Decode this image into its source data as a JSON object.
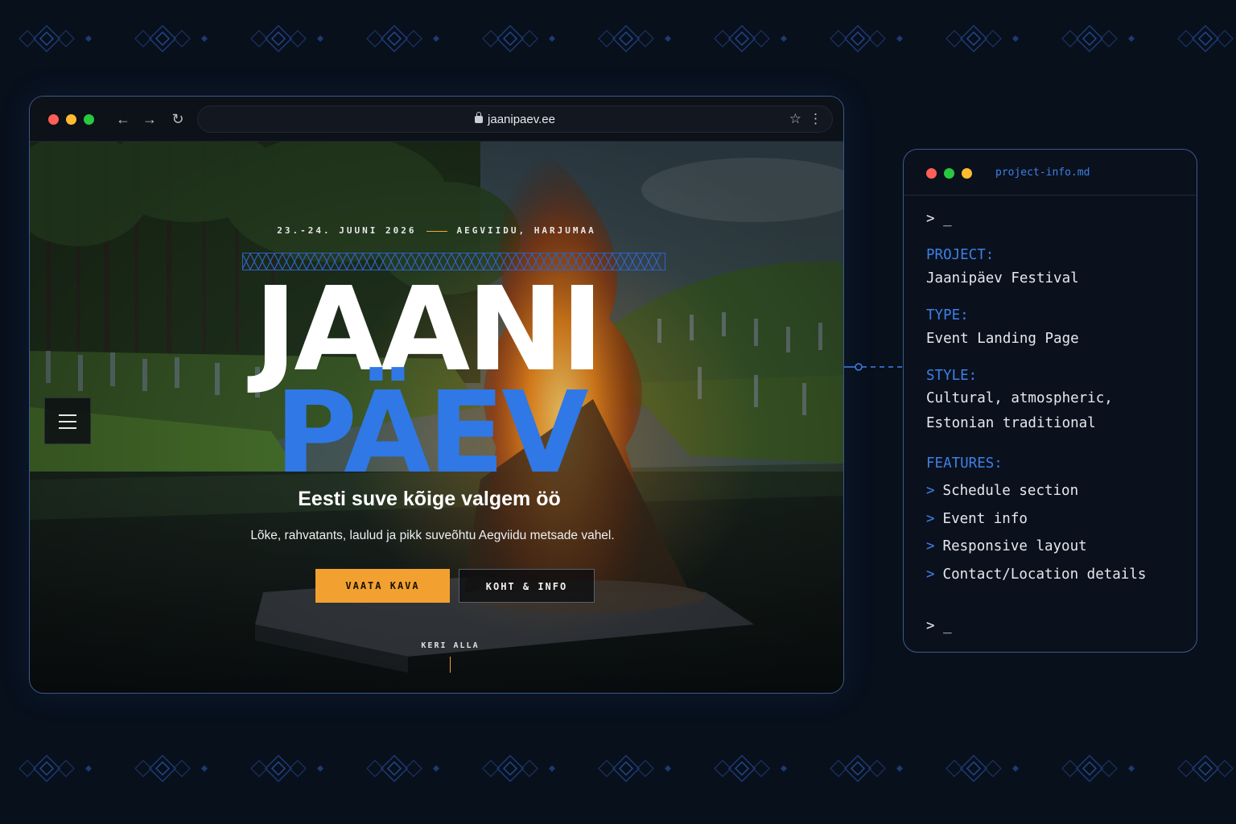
{
  "browser": {
    "url": "jaanipaev.ee",
    "traffic_colors": [
      "#ff5f57",
      "#febc2e",
      "#28c840"
    ]
  },
  "hero": {
    "date_text": "23.-24. JUUNI 2026",
    "location_text": "AEGVIIDU, HARJUMAA",
    "title_line1": "JAANI",
    "title_line2": "PÄEV",
    "tagline": "Eesti suve kõige valgem öö",
    "subline": "Lõke, rahvatants, laulud ja pikk suveõhtu Aegviidu metsade vahel.",
    "primary_button": "VAATA KAVA",
    "secondary_button": "KOHT & INFO",
    "scroll_label": "KERI ALLA",
    "accent_blue": "#2f78e6",
    "accent_orange": "#f2a131"
  },
  "panel": {
    "filename": "project-info.md",
    "prompt_top": "> _",
    "project_key": "PROJECT:",
    "project_value": "Jaanipäev Festival",
    "type_key": "TYPE:",
    "type_value": "Event Landing Page",
    "style_key": "STYLE:",
    "style_value_1": "Cultural, atmospheric,",
    "style_value_2": "Estonian traditional",
    "features_key": "FEATURES:",
    "features": [
      "Schedule section",
      "Event info",
      "Responsive layout",
      "Contact/Location details"
    ],
    "bullet": ">",
    "prompt_bottom": "> _"
  }
}
